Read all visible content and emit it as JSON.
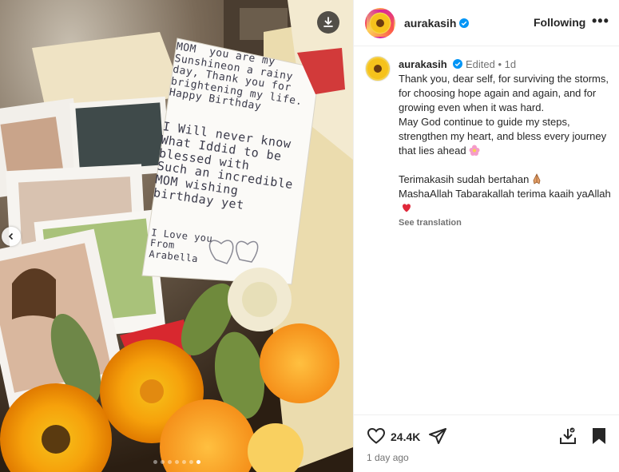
{
  "post": {
    "username": "aurakasih",
    "follow_status": "Following",
    "more_label": "•••",
    "caption": {
      "edited_label": "Edited",
      "separator": "•",
      "age": "1d",
      "lines": [
        "Thank you, dear self, for surviving the storms, for choosing hope again and again, and for growing even when it was hard.",
        "May God continue to guide my steps, strengthen my heart, and bless every journey that lies ahead",
        "",
        "Terimakasih sudah bertahan",
        "MashaAllah Tabarakallah terima kaaih yaAllah"
      ],
      "see_translation": "See translation"
    },
    "likes": "24.4K",
    "timestamp": "1 day ago"
  },
  "media": {
    "note_text": "MOM  you are my\nSunshineon a rainy\nday, Thank you for\nbrightening my life.\nHappy Birthday",
    "note_text2": "I Will never know\nWhat Iddid to be\nblessed with\nSuch an incredible\nMOM wishing\nbirthday yet",
    "note_text3": "I Love you\nFrom\nArabella",
    "carousel_dots": 7,
    "active_dot": 6
  },
  "icons": {
    "verified": "verified-badge-icon",
    "like": "heart-icon",
    "share": "paper-plane-icon",
    "download": "download-icon",
    "bookmark": "bookmark-icon"
  },
  "colors": {
    "verified": "#0095f6",
    "text": "#262626",
    "muted": "#737373",
    "divider": "#efefef"
  }
}
